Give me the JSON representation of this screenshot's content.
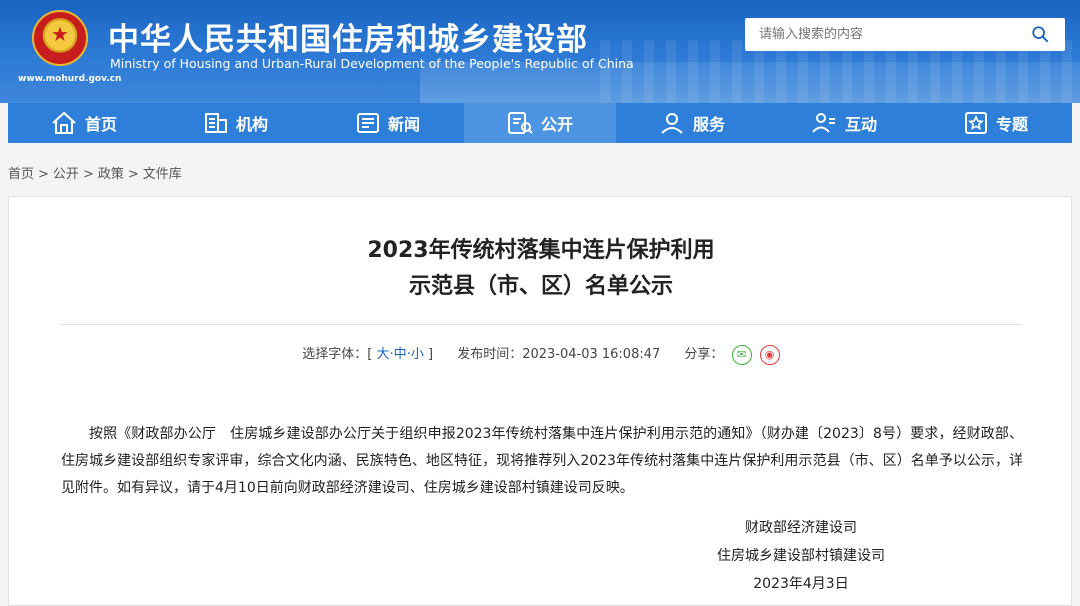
{
  "header": {
    "title": "中华人民共和国住房和城乡建设部",
    "subtitle": "Ministry of Housing and Urban-Rural Development of the People's Republic of China",
    "url": "www.mohurd.gov.cn",
    "search_placeholder": "请输入搜索的内容"
  },
  "nav": [
    {
      "label": "首页",
      "icon": "home-icon"
    },
    {
      "label": "机构",
      "icon": "building-icon"
    },
    {
      "label": "新闻",
      "icon": "news-icon"
    },
    {
      "label": "公开",
      "icon": "disclosure-icon",
      "active": true
    },
    {
      "label": "服务",
      "icon": "service-icon"
    },
    {
      "label": "互动",
      "icon": "interaction-icon"
    },
    {
      "label": "专题",
      "icon": "topic-icon"
    }
  ],
  "breadcrumb": [
    "首页",
    "公开",
    "政策",
    "文件库"
  ],
  "article": {
    "title_line1": "2023年传统村落集中连片保护利用",
    "title_line2": "示范县（市、区）名单公示",
    "font_label": "选择字体：",
    "font_sizes": [
      "大",
      "中",
      "小"
    ],
    "publish_label": "发布时间：",
    "publish_time": "2023-04-03 16:08:47",
    "share_label": "分享：",
    "body": "按照《财政部办公厅　住房城乡建设部办公厅关于组织申报2023年传统村落集中连片保护利用示范的通知》（财办建〔2023〕8号）要求，经财政部、住房城乡建设部组织专家评审，综合文化内涵、民族特色、地区特征，现将推荐列入2023年传统村落集中连片保护利用示范县（市、区）名单予以公示，详见附件。如有异议，请于4月10日前向财政部经济建设司、住房城乡建设部村镇建设司反映。",
    "signer1": "财政部经济建设司",
    "signer2": "住房城乡建设部村镇建设司",
    "sign_date": "2023年4月3日"
  },
  "colors": {
    "primary": "#1a64c2",
    "nav": "#2e7fd9",
    "nav_active": "#4d94e2",
    "wechat": "#3bb13b",
    "weibo": "#e5383b"
  }
}
